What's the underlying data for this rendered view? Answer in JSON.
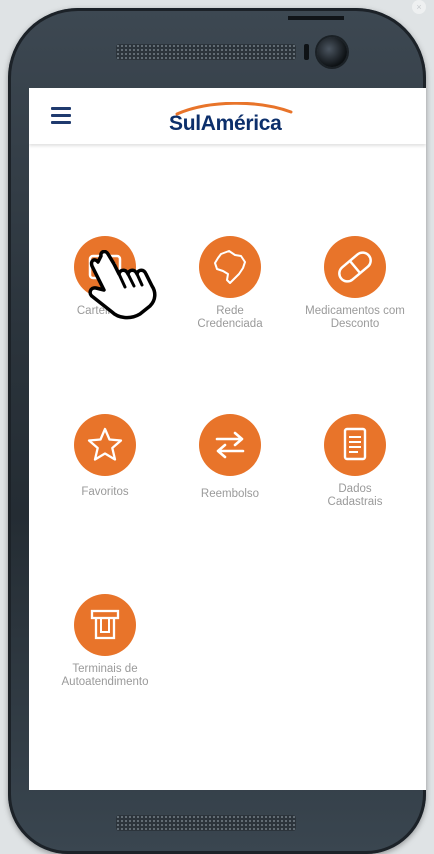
{
  "app": {
    "brand": "SulAmérica",
    "accent_color": "#e8742a",
    "brand_color": "#0c2f6b"
  },
  "header": {
    "menu_icon": "hamburger-icon"
  },
  "tiles": [
    {
      "label": "Carteirinha",
      "icon": "card-icon"
    },
    {
      "label": "Rede\nCredenciada",
      "icon": "brazil-map-icon"
    },
    {
      "label": "Medicamentos com\nDesconto",
      "icon": "pill-icon"
    },
    {
      "label": "Favoritos",
      "icon": "star-icon"
    },
    {
      "label": "Reembolso",
      "icon": "exchange-arrows-icon"
    },
    {
      "label": "Dados\nCadastrais",
      "icon": "document-icon"
    },
    {
      "label": "Terminais de\nAutoatendimento",
      "icon": "atm-terminal-icon"
    }
  ],
  "overlay": {
    "cursor_icon": "hand-pointer-icon",
    "close_icon": "close-icon",
    "close_glyph": "×"
  }
}
